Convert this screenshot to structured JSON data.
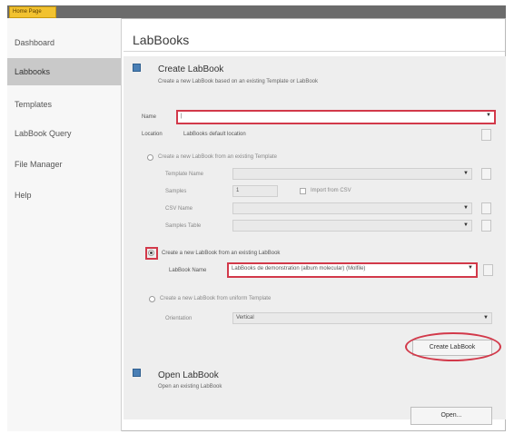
{
  "app": {
    "home_tab": "Home Page"
  },
  "sidebar": {
    "items": [
      {
        "label": "Dashboard"
      },
      {
        "label": "Labbooks"
      },
      {
        "label": "Templates"
      },
      {
        "label": "LabBook Query"
      },
      {
        "label": "File Manager"
      },
      {
        "label": "Help"
      }
    ]
  },
  "main": {
    "title": "LabBooks"
  },
  "create": {
    "title": "Create LabBook",
    "subtitle": "Create a new LabBook based on an existing Template or LabBook",
    "name_label": "Name",
    "name_value": "|",
    "location_label": "Location",
    "location_value": "LabBooks default location",
    "from_template": {
      "label": "Create a new LabBook from an existing Template",
      "template_name_label": "Template Name",
      "samples_label": "Samples",
      "samples_value": "1",
      "import_csv_label": "Import from CSV",
      "csv_name_label": "CSV Name",
      "samples_table_label": "Samples Table"
    },
    "from_labbook": {
      "label": "Create a new LabBook from an existing LabBook",
      "labbook_name_label": "LabBook Name",
      "labbook_name_value": "LabBooks de demonstration (album molecular) (Molfile)"
    },
    "from_uniform": {
      "label": "Create a new LabBook from uniform Template",
      "orientation_label": "Orientation",
      "orientation_value": "Vertical"
    },
    "create_button": "Create LabBook"
  },
  "open": {
    "title": "Open LabBook",
    "subtitle": "Open an existing LabBook",
    "open_button": "Open..."
  }
}
